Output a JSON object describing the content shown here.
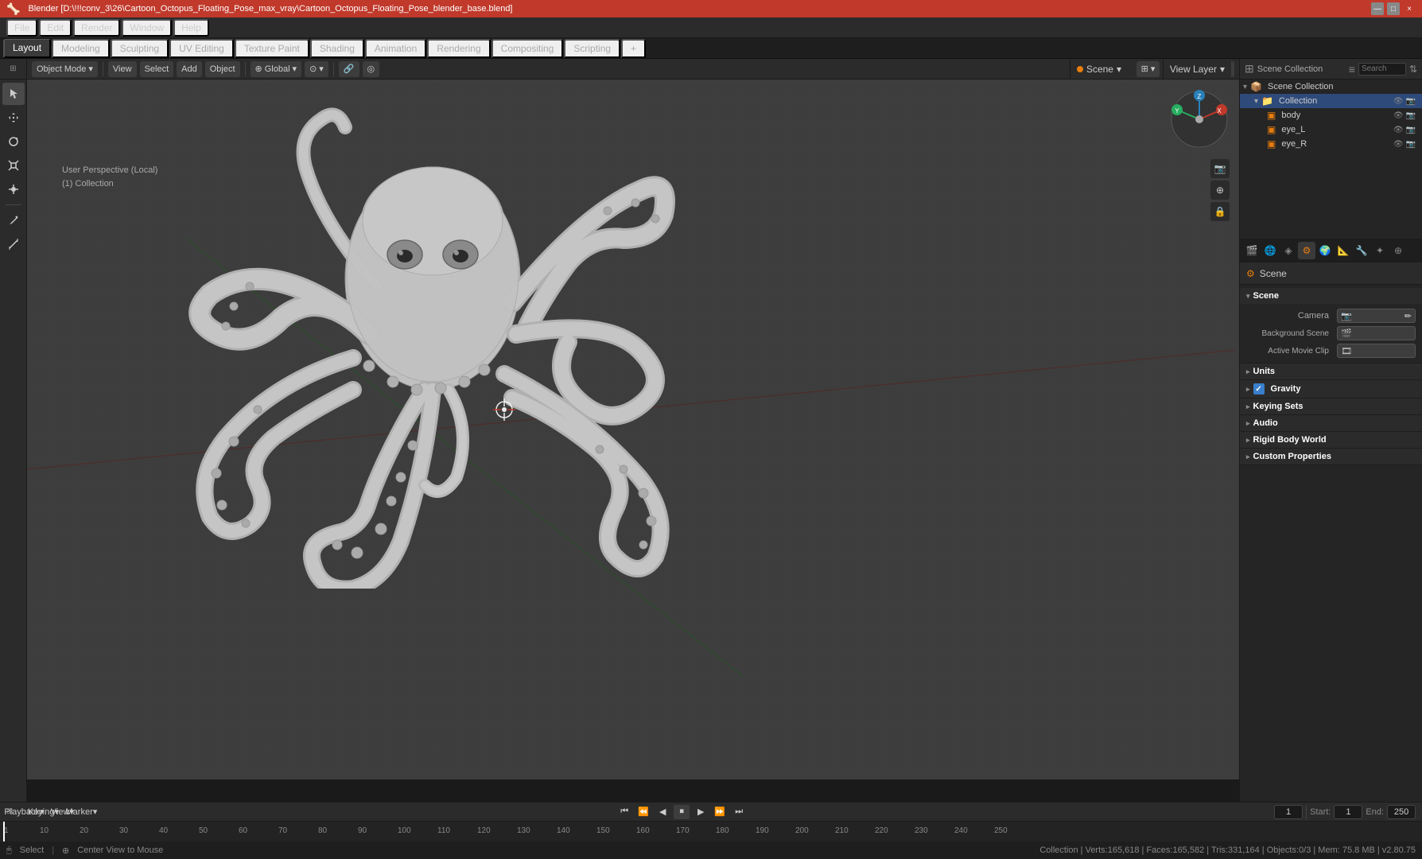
{
  "titleBar": {
    "title": "Blender [D:\\!!!conv_3\\26\\Cartoon_Octopus_Floating_Pose_max_vray\\Cartoon_Octopus_Floating_Pose_blender_base.blend]",
    "controls": [
      "—",
      "□",
      "×"
    ]
  },
  "menuBar": {
    "items": [
      "File",
      "Edit",
      "Render",
      "Window",
      "Help"
    ]
  },
  "workspaceTabs": {
    "tabs": [
      "Layout",
      "Modeling",
      "Sculpting",
      "UV Editing",
      "Texture Paint",
      "Shading",
      "Animation",
      "Rendering",
      "Compositing",
      "Scripting",
      "+"
    ],
    "activeTab": "Layout"
  },
  "viewportHeader": {
    "objectMode": "Object Mode",
    "view": "View",
    "select": "Select",
    "add": "Add",
    "object": "Object",
    "global": "Global",
    "proportionalEdit": "◎",
    "snap": "🔗",
    "icons": [
      "⊞",
      "◈",
      "⊙"
    ]
  },
  "viewportInfo": {
    "line1": "User Perspective (Local)",
    "line2": "(1) Collection"
  },
  "sceneBadge": {
    "label": "Scene",
    "icon": "scene-icon"
  },
  "viewLayerBadge": {
    "label": "View Layer",
    "icon": "layer-icon"
  },
  "outliner": {
    "title": "Scene Collection",
    "items": [
      {
        "label": "Scene Collection",
        "icon": "📁",
        "indent": 0,
        "expanded": true
      },
      {
        "label": "Collection",
        "icon": "📁",
        "indent": 1,
        "expanded": true,
        "active": false
      },
      {
        "label": "body",
        "icon": "▣",
        "indent": 2,
        "active": false
      },
      {
        "label": "eye_L",
        "icon": "▣",
        "indent": 2,
        "active": false
      },
      {
        "label": "eye_R",
        "icon": "▣",
        "indent": 2,
        "active": false
      }
    ]
  },
  "propertiesPanel": {
    "icons": [
      "🎬",
      "🌐",
      "📷",
      "💡",
      "🎨",
      "📐",
      "⚙",
      "🔧",
      "✦"
    ],
    "activeIcon": 7,
    "sceneName": "Scene",
    "sections": [
      {
        "id": "scene",
        "label": "Scene",
        "expanded": true,
        "fields": [
          {
            "label": "Camera",
            "value": "",
            "type": "dropdown",
            "icon": "📷"
          },
          {
            "label": "Background Scene",
            "value": "",
            "type": "dropdown",
            "icon": "🎬"
          },
          {
            "label": "Active Movie Clip",
            "value": "",
            "type": "dropdown",
            "icon": "🎞"
          }
        ]
      },
      {
        "id": "units",
        "label": "Units",
        "expanded": false,
        "fields": []
      },
      {
        "id": "gravity",
        "label": "Gravity",
        "expanded": false,
        "fields": [],
        "checkbox": true
      },
      {
        "id": "keyingSets",
        "label": "Keying Sets",
        "expanded": false,
        "fields": []
      },
      {
        "id": "audio",
        "label": "Audio",
        "expanded": false,
        "fields": []
      },
      {
        "id": "rigidBodyWorld",
        "label": "Rigid Body World",
        "expanded": false,
        "fields": []
      },
      {
        "id": "customProperties",
        "label": "Custom Properties",
        "expanded": false,
        "fields": []
      }
    ]
  },
  "timeline": {
    "playbackLabel": "Playback",
    "keyingLabel": "Keying",
    "viewLabel": "View",
    "markerLabel": "Marker",
    "frameStart": 1,
    "frameEnd": 250,
    "currentFrame": 1,
    "startLabel": "Start:",
    "endLabel": "End:",
    "startValue": "1",
    "endValue": "250",
    "currentValue": "1",
    "frameNumbers": [
      1,
      10,
      20,
      30,
      40,
      50,
      60,
      70,
      80,
      90,
      100,
      110,
      120,
      130,
      140,
      150,
      160,
      170,
      180,
      190,
      200,
      210,
      220,
      230,
      240,
      250
    ]
  },
  "statusBar": {
    "select": "Select",
    "centerView": "Center View to Mouse",
    "stats": "Collection | Verts:165,618 | Faces:165,582 | Tris:331,164 | Objects:0/3 | Mem: 75.8 MB | v2.80.75"
  },
  "viewport": {
    "bgColor": "#3d3d3d",
    "gridColor": "#4a4a4a"
  }
}
